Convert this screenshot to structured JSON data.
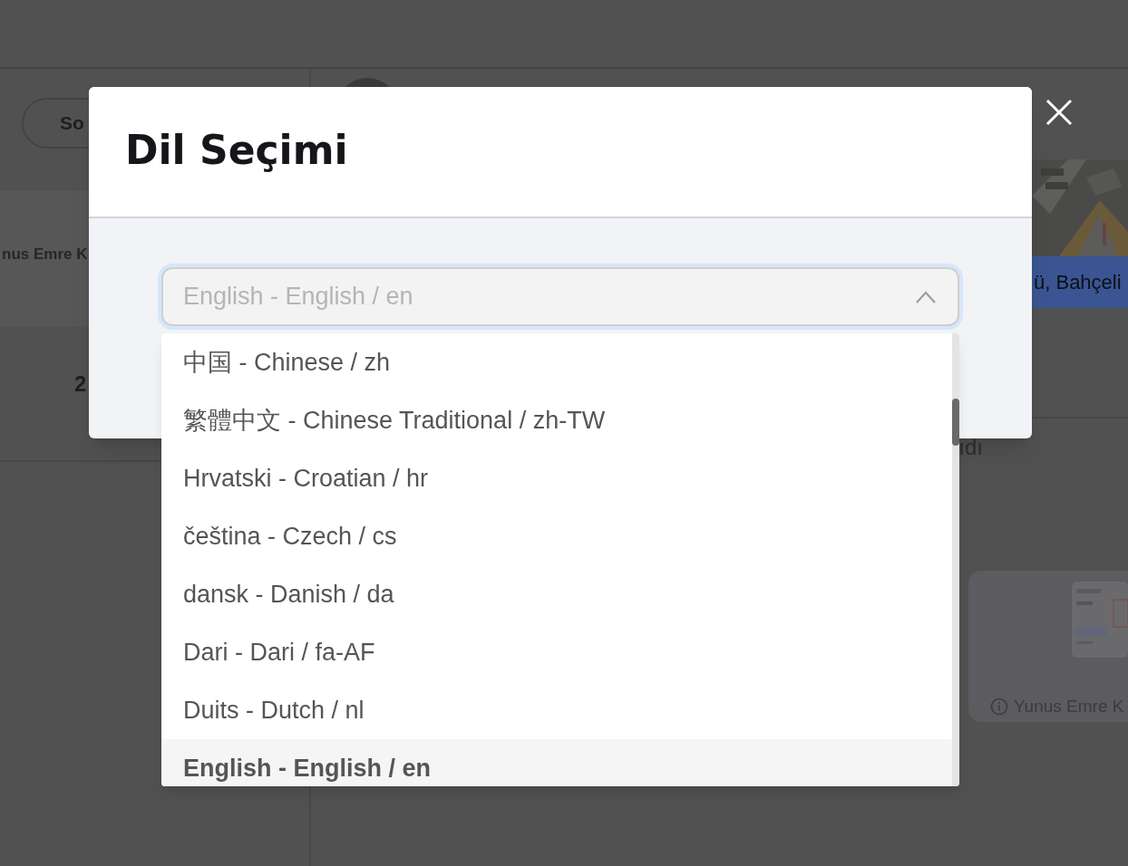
{
  "background": {
    "button_label": "So",
    "name_text": "nus Emre K",
    "count": "2",
    "address": "ü, Bahçeli",
    "text_fragment": "ıdı",
    "card_caption": "Yunus Emre K"
  },
  "dialog": {
    "title": "Dil Seçimi",
    "select": {
      "value": "English - English / en",
      "expanded": true
    },
    "options": [
      {
        "label": "中国 - Chinese / zh",
        "selected": false
      },
      {
        "label": "繁體中文 - Chinese Traditional / zh-TW",
        "selected": false
      },
      {
        "label": "Hrvatski - Croatian / hr",
        "selected": false
      },
      {
        "label": "čeština - Czech / cs",
        "selected": false
      },
      {
        "label": "dansk - Danish / da",
        "selected": false
      },
      {
        "label": "Dari - Dari / fa-AF",
        "selected": false
      },
      {
        "label": "Duits - Dutch / nl",
        "selected": false
      },
      {
        "label": "English - English / en",
        "selected": true
      }
    ]
  }
}
